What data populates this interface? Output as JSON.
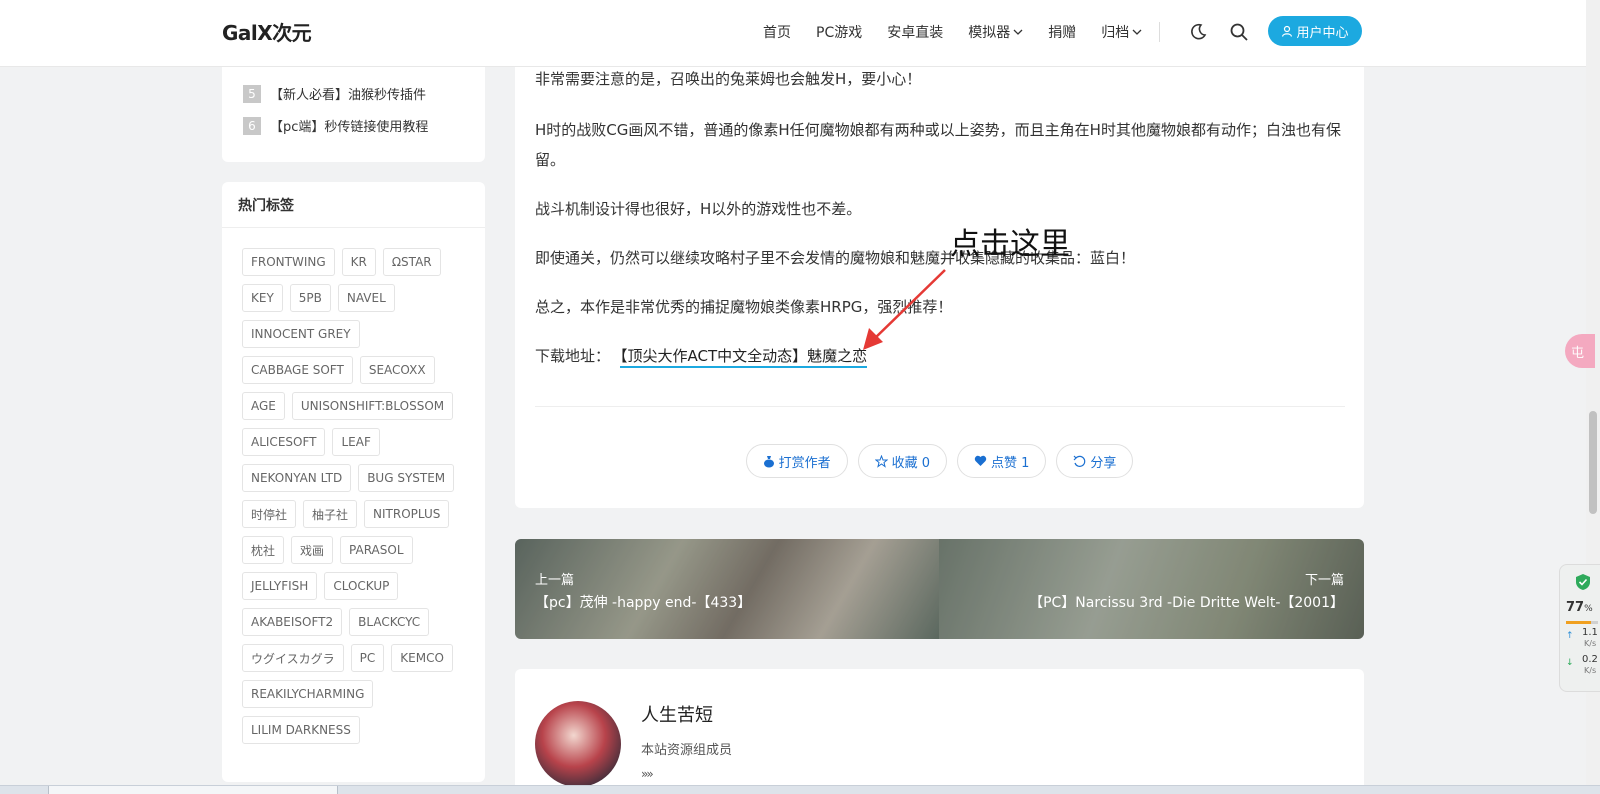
{
  "header": {
    "logo": "GalX次元",
    "nav": [
      "首页",
      "PC游戏",
      "安卓直装",
      "模拟器",
      "捐赠",
      "归档"
    ],
    "user_button": "用户中心"
  },
  "sidebar": {
    "ranking": [
      {
        "num": "5",
        "label": "【新人必看】油猴秒传插件"
      },
      {
        "num": "6",
        "label": "【pc端】秒传链接使用教程"
      }
    ],
    "tags_title": "热门标签",
    "tags": [
      "FRONTWING",
      "KR",
      "ΩSTAR",
      "KEY",
      "5PB",
      "NAVEL",
      "INNOCENT GREY",
      "CABBAGE SOFT",
      "SEACOXX",
      "AGE",
      "UNISONSHIFT:BLOSSOM",
      "ALICESOFT",
      "LEAF",
      "NEKONYAN LTD",
      "BUG SYSTEM",
      "时停社",
      "柚子社",
      "NITROPLUS",
      "枕社",
      "戏画",
      "PARASOL",
      "JELLYFISH",
      "CLOCKUP",
      "AKABEISOFT2",
      "BLACKCYC",
      "ウグイスカグラ",
      "PC",
      "KEMCO",
      "REAKILYCHARMING",
      "LILIM DARKNESS"
    ]
  },
  "article": {
    "paragraphs": [
      "非常需要注意的是，召唤出的兔莱姆也会触发H，要小心！",
      "H时的战败CG画风不错，普通的像素H任何魔物娘都有两种或以上姿势，而且主角在H时其他魔物娘都有动作；白浊也有保留。",
      "战斗机制设计得也很好，H以外的游戏性也不差。",
      "即使通关，仍然可以继续攻略村子里不会发情的魔物娘和魅魔并收集隐藏的收集品：蓝白！",
      "总之，本作是非常优秀的捕捉魔物娘类像素HRPG，强烈推荐！"
    ],
    "download_label": "下载地址：",
    "download_link": "【顶尖大作ACT中文全动态】魅魔之恋",
    "annotation": "点击这里",
    "actions": [
      "打赏作者",
      "收藏 0",
      "点赞 1",
      "分享"
    ]
  },
  "post_nav": {
    "prev_label": "上一篇",
    "prev_title": "【pc】茂伸 -happy end-【433】",
    "next_label": "下一篇",
    "next_title": "【PC】Narcissu 3rd -Die Dritte Welt-【2001】"
  },
  "author": {
    "name": "人生苦短",
    "role": "本站资源组成员",
    "more": "»»"
  },
  "widgets": {
    "float_button": "屯",
    "net_percent": "77",
    "net_percent_unit": "%",
    "net_level": 0.77,
    "upload": "1.1",
    "download": "0.2",
    "unit": "K/s"
  },
  "colors": {
    "accent": "#1ca9e0",
    "link_blue": "#1a6fd1",
    "annotation_arrow": "#e53935"
  }
}
